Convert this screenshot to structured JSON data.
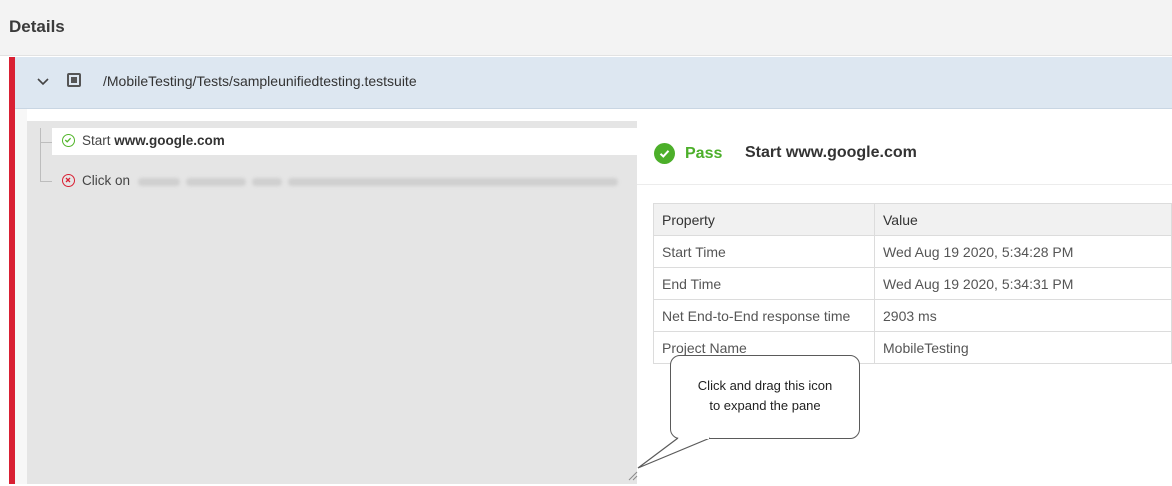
{
  "details": {
    "title": "Details"
  },
  "suite": {
    "path": "/MobileTesting/Tests/sampleunifiedtesting.testsuite"
  },
  "steps": [
    {
      "status": "pass",
      "prefix": "Start ",
      "target": "www.google.com"
    },
    {
      "status": "fail",
      "prefix": "Click on ",
      "target": ""
    }
  ],
  "result": {
    "status_label": "Pass",
    "step_title": "Start www.google.com",
    "table": {
      "headers": [
        "Property",
        "Value"
      ],
      "rows": [
        [
          "Start Time",
          "Wed Aug 19 2020, 5:34:28 PM"
        ],
        [
          "End Time",
          "Wed Aug 19 2020, 5:34:31 PM"
        ],
        [
          "Net End-to-End response time",
          "2903 ms"
        ],
        [
          "Project Name",
          "MobileTesting"
        ]
      ]
    }
  },
  "callout": {
    "line1": "Click and drag this icon",
    "line2": "to expand the pane"
  },
  "colors": {
    "pass": "#4caf2a",
    "fail": "#d92033",
    "suite_bg": "#dde7f1"
  },
  "icons": {
    "expand": "chevron-down-icon",
    "suite": "test-suite-icon",
    "pass": "check-circle-icon",
    "fail": "x-circle-icon",
    "resize": "resize-handle-icon"
  }
}
